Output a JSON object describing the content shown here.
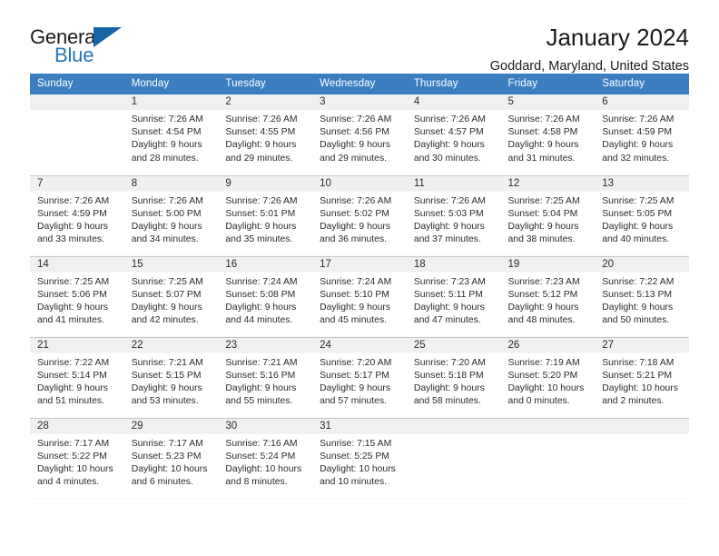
{
  "brand": {
    "name_part1": "General",
    "name_part2": "Blue",
    "triangle_color": "#1565a8",
    "blue_color": "#2476bd",
    "logo_icon": "triangle-icon"
  },
  "header": {
    "title": "January 2024",
    "subtitle": "Goddard, Maryland, United States"
  },
  "theme": {
    "header_bg": "#3c7ebf",
    "header_text": "#ffffff",
    "daynum_band": "#f0f0f0",
    "row_divider": "#c8c8c8",
    "body_text": "#2b2b2b"
  },
  "calendar": {
    "weekday_headers": [
      "Sunday",
      "Monday",
      "Tuesday",
      "Wednesday",
      "Thursday",
      "Friday",
      "Saturday"
    ],
    "labels": {
      "sunrise": "Sunrise:",
      "sunset": "Sunset:",
      "daylight": "Daylight:"
    },
    "weeks": [
      [
        {
          "day": ""
        },
        {
          "day": "1",
          "sunrise": "Sunrise: 7:26 AM",
          "sunset": "Sunset: 4:54 PM",
          "daylight_line1": "Daylight: 9 hours",
          "daylight_line2": "and 28 minutes."
        },
        {
          "day": "2",
          "sunrise": "Sunrise: 7:26 AM",
          "sunset": "Sunset: 4:55 PM",
          "daylight_line1": "Daylight: 9 hours",
          "daylight_line2": "and 29 minutes."
        },
        {
          "day": "3",
          "sunrise": "Sunrise: 7:26 AM",
          "sunset": "Sunset: 4:56 PM",
          "daylight_line1": "Daylight: 9 hours",
          "daylight_line2": "and 29 minutes."
        },
        {
          "day": "4",
          "sunrise": "Sunrise: 7:26 AM",
          "sunset": "Sunset: 4:57 PM",
          "daylight_line1": "Daylight: 9 hours",
          "daylight_line2": "and 30 minutes."
        },
        {
          "day": "5",
          "sunrise": "Sunrise: 7:26 AM",
          "sunset": "Sunset: 4:58 PM",
          "daylight_line1": "Daylight: 9 hours",
          "daylight_line2": "and 31 minutes."
        },
        {
          "day": "6",
          "sunrise": "Sunrise: 7:26 AM",
          "sunset": "Sunset: 4:59 PM",
          "daylight_line1": "Daylight: 9 hours",
          "daylight_line2": "and 32 minutes."
        }
      ],
      [
        {
          "day": "7",
          "sunrise": "Sunrise: 7:26 AM",
          "sunset": "Sunset: 4:59 PM",
          "daylight_line1": "Daylight: 9 hours",
          "daylight_line2": "and 33 minutes."
        },
        {
          "day": "8",
          "sunrise": "Sunrise: 7:26 AM",
          "sunset": "Sunset: 5:00 PM",
          "daylight_line1": "Daylight: 9 hours",
          "daylight_line2": "and 34 minutes."
        },
        {
          "day": "9",
          "sunrise": "Sunrise: 7:26 AM",
          "sunset": "Sunset: 5:01 PM",
          "daylight_line1": "Daylight: 9 hours",
          "daylight_line2": "and 35 minutes."
        },
        {
          "day": "10",
          "sunrise": "Sunrise: 7:26 AM",
          "sunset": "Sunset: 5:02 PM",
          "daylight_line1": "Daylight: 9 hours",
          "daylight_line2": "and 36 minutes."
        },
        {
          "day": "11",
          "sunrise": "Sunrise: 7:26 AM",
          "sunset": "Sunset: 5:03 PM",
          "daylight_line1": "Daylight: 9 hours",
          "daylight_line2": "and 37 minutes."
        },
        {
          "day": "12",
          "sunrise": "Sunrise: 7:25 AM",
          "sunset": "Sunset: 5:04 PM",
          "daylight_line1": "Daylight: 9 hours",
          "daylight_line2": "and 38 minutes."
        },
        {
          "day": "13",
          "sunrise": "Sunrise: 7:25 AM",
          "sunset": "Sunset: 5:05 PM",
          "daylight_line1": "Daylight: 9 hours",
          "daylight_line2": "and 40 minutes."
        }
      ],
      [
        {
          "day": "14",
          "sunrise": "Sunrise: 7:25 AM",
          "sunset": "Sunset: 5:06 PM",
          "daylight_line1": "Daylight: 9 hours",
          "daylight_line2": "and 41 minutes."
        },
        {
          "day": "15",
          "sunrise": "Sunrise: 7:25 AM",
          "sunset": "Sunset: 5:07 PM",
          "daylight_line1": "Daylight: 9 hours",
          "daylight_line2": "and 42 minutes."
        },
        {
          "day": "16",
          "sunrise": "Sunrise: 7:24 AM",
          "sunset": "Sunset: 5:08 PM",
          "daylight_line1": "Daylight: 9 hours",
          "daylight_line2": "and 44 minutes."
        },
        {
          "day": "17",
          "sunrise": "Sunrise: 7:24 AM",
          "sunset": "Sunset: 5:10 PM",
          "daylight_line1": "Daylight: 9 hours",
          "daylight_line2": "and 45 minutes."
        },
        {
          "day": "18",
          "sunrise": "Sunrise: 7:23 AM",
          "sunset": "Sunset: 5:11 PM",
          "daylight_line1": "Daylight: 9 hours",
          "daylight_line2": "and 47 minutes."
        },
        {
          "day": "19",
          "sunrise": "Sunrise: 7:23 AM",
          "sunset": "Sunset: 5:12 PM",
          "daylight_line1": "Daylight: 9 hours",
          "daylight_line2": "and 48 minutes."
        },
        {
          "day": "20",
          "sunrise": "Sunrise: 7:22 AM",
          "sunset": "Sunset: 5:13 PM",
          "daylight_line1": "Daylight: 9 hours",
          "daylight_line2": "and 50 minutes."
        }
      ],
      [
        {
          "day": "21",
          "sunrise": "Sunrise: 7:22 AM",
          "sunset": "Sunset: 5:14 PM",
          "daylight_line1": "Daylight: 9 hours",
          "daylight_line2": "and 51 minutes."
        },
        {
          "day": "22",
          "sunrise": "Sunrise: 7:21 AM",
          "sunset": "Sunset: 5:15 PM",
          "daylight_line1": "Daylight: 9 hours",
          "daylight_line2": "and 53 minutes."
        },
        {
          "day": "23",
          "sunrise": "Sunrise: 7:21 AM",
          "sunset": "Sunset: 5:16 PM",
          "daylight_line1": "Daylight: 9 hours",
          "daylight_line2": "and 55 minutes."
        },
        {
          "day": "24",
          "sunrise": "Sunrise: 7:20 AM",
          "sunset": "Sunset: 5:17 PM",
          "daylight_line1": "Daylight: 9 hours",
          "daylight_line2": "and 57 minutes."
        },
        {
          "day": "25",
          "sunrise": "Sunrise: 7:20 AM",
          "sunset": "Sunset: 5:18 PM",
          "daylight_line1": "Daylight: 9 hours",
          "daylight_line2": "and 58 minutes."
        },
        {
          "day": "26",
          "sunrise": "Sunrise: 7:19 AM",
          "sunset": "Sunset: 5:20 PM",
          "daylight_line1": "Daylight: 10 hours",
          "daylight_line2": "and 0 minutes."
        },
        {
          "day": "27",
          "sunrise": "Sunrise: 7:18 AM",
          "sunset": "Sunset: 5:21 PM",
          "daylight_line1": "Daylight: 10 hours",
          "daylight_line2": "and 2 minutes."
        }
      ],
      [
        {
          "day": "28",
          "sunrise": "Sunrise: 7:17 AM",
          "sunset": "Sunset: 5:22 PM",
          "daylight_line1": "Daylight: 10 hours",
          "daylight_line2": "and 4 minutes."
        },
        {
          "day": "29",
          "sunrise": "Sunrise: 7:17 AM",
          "sunset": "Sunset: 5:23 PM",
          "daylight_line1": "Daylight: 10 hours",
          "daylight_line2": "and 6 minutes."
        },
        {
          "day": "30",
          "sunrise": "Sunrise: 7:16 AM",
          "sunset": "Sunset: 5:24 PM",
          "daylight_line1": "Daylight: 10 hours",
          "daylight_line2": "and 8 minutes."
        },
        {
          "day": "31",
          "sunrise": "Sunrise: 7:15 AM",
          "sunset": "Sunset: 5:25 PM",
          "daylight_line1": "Daylight: 10 hours",
          "daylight_line2": "and 10 minutes."
        },
        {
          "day": ""
        },
        {
          "day": ""
        },
        {
          "day": ""
        }
      ]
    ]
  }
}
